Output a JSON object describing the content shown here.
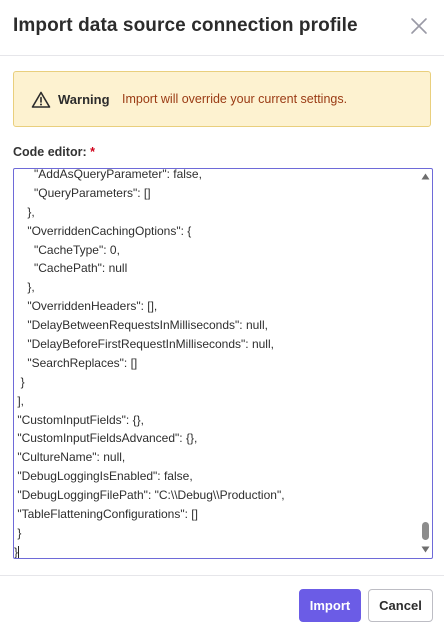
{
  "dialog": {
    "title": "Import data source connection profile",
    "close_icon": "close-icon"
  },
  "warning": {
    "icon": "warning-triangle-icon",
    "title": "Warning",
    "message": "Import will override your current settings."
  },
  "editor": {
    "label": "Code editor:",
    "required_marker": "*",
    "lines": [
      "      \"AddAsQueryParameter\": false,",
      "      \"QueryParameters\": []",
      "    },",
      "    \"OverriddenCachingOptions\": {",
      "      \"CacheType\": 0,",
      "      \"CachePath\": null",
      "    },",
      "    \"OverriddenHeaders\": [],",
      "    \"DelayBetweenRequestsInMilliseconds\": null,",
      "    \"DelayBeforeFirstRequestInMilliseconds\": null,",
      "    \"SearchReplaces\": []",
      "  }",
      " ],",
      " \"CustomInputFields\": {},",
      " \"CustomInputFieldsAdvanced\": {},",
      " \"CultureName\": null,",
      " \"DebugLoggingIsEnabled\": false,",
      " \"DebugLoggingFilePath\": \"C:\\\\Debug\\\\Production\",",
      " \"TableFlatteningConfigurations\": []",
      " }",
      "}"
    ]
  },
  "footer": {
    "import_label": "Import",
    "cancel_label": "Cancel"
  },
  "colors": {
    "primary": "#6b5ce6",
    "warning_bg": "#fdf2d0",
    "warning_border": "#e9cf7d",
    "warning_text": "#9a3b14",
    "required": "#d0021b",
    "editor_border": "#6e6ad8"
  }
}
